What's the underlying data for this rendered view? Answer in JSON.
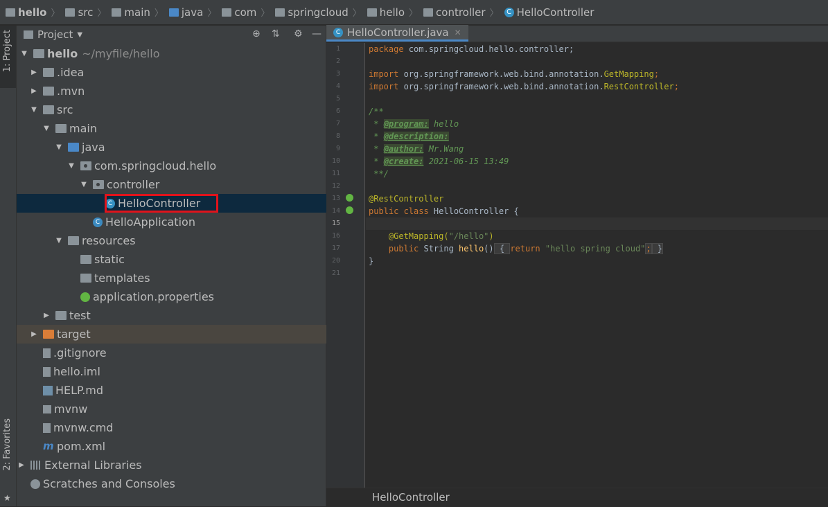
{
  "breadcrumb": [
    "hello",
    "src",
    "main",
    "java",
    "com",
    "springcloud",
    "hello",
    "controller",
    "HelloController"
  ],
  "left_tabs": {
    "project": "1: Project",
    "favorites": "2: Favorites"
  },
  "project_panel": {
    "title": "Project",
    "tree": [
      {
        "label": "hello",
        "extra": "~/myfile/hello"
      },
      {
        "label": ".idea"
      },
      {
        "label": ".mvn"
      },
      {
        "label": "src"
      },
      {
        "label": "main"
      },
      {
        "label": "java"
      },
      {
        "label": "com.springcloud.hello"
      },
      {
        "label": "controller"
      },
      {
        "label": "HelloController"
      },
      {
        "label": "HelloApplication"
      },
      {
        "label": "resources"
      },
      {
        "label": "static"
      },
      {
        "label": "templates"
      },
      {
        "label": "application.properties"
      },
      {
        "label": "test"
      },
      {
        "label": "target"
      },
      {
        "label": ".gitignore"
      },
      {
        "label": "hello.iml"
      },
      {
        "label": "HELP.md"
      },
      {
        "label": "mvnw"
      },
      {
        "label": "mvnw.cmd"
      },
      {
        "label": "pom.xml"
      },
      {
        "label": "External Libraries"
      },
      {
        "label": "Scratches and Consoles"
      }
    ]
  },
  "editor": {
    "tab_label": "HelloController.java",
    "line_numbers": [
      "1",
      "2",
      "3",
      "4",
      "5",
      "6",
      "7",
      "8",
      "9",
      "10",
      "11",
      "12",
      "13",
      "14",
      "15",
      "16",
      "17",
      "20",
      "21"
    ],
    "code": {
      "l1_kw": "package",
      "l1_rest": " com.springcloud.hello.controller;",
      "l3_kw": "import",
      "l3_rest": " org.springframework.web.bind.annotation.",
      "l3_cls": "GetMapping",
      "l3_end": ";",
      "l4_kw": "import",
      "l4_rest": " org.springframework.web.bind.annotation.",
      "l4_cls": "RestController",
      "l4_end": ";",
      "l6": "/**",
      "l7_pre": " * ",
      "l7_tag": "@program:",
      "l7_val": " hello",
      "l8_pre": " * ",
      "l8_tag": "@description:",
      "l9_pre": " * ",
      "l9_tag": "@author:",
      "l9_val": " Mr.Wang",
      "l10_pre": " * ",
      "l10_tag": "@create:",
      "l10_val": " 2021-06-15 13:49",
      "l11": " **/",
      "l13": "@RestController",
      "l14_kw": "public class",
      "l14_rest": " HelloController {",
      "l16_ann": "    @GetMapping(",
      "l16_str": "\"/hello\"",
      "l16_end": ")",
      "l17_kw1": "    public",
      "l17_type": " String ",
      "l17_fn": "hello",
      "l17_paren": "()",
      "l17_open": " { ",
      "l17_kw2": "return",
      "l17_str": " \"hello spring cloud\"",
      "l17_semi": ";",
      "l17_close": " }",
      "l20": "}"
    }
  },
  "status": {
    "breadcrumb": "HelloController"
  }
}
